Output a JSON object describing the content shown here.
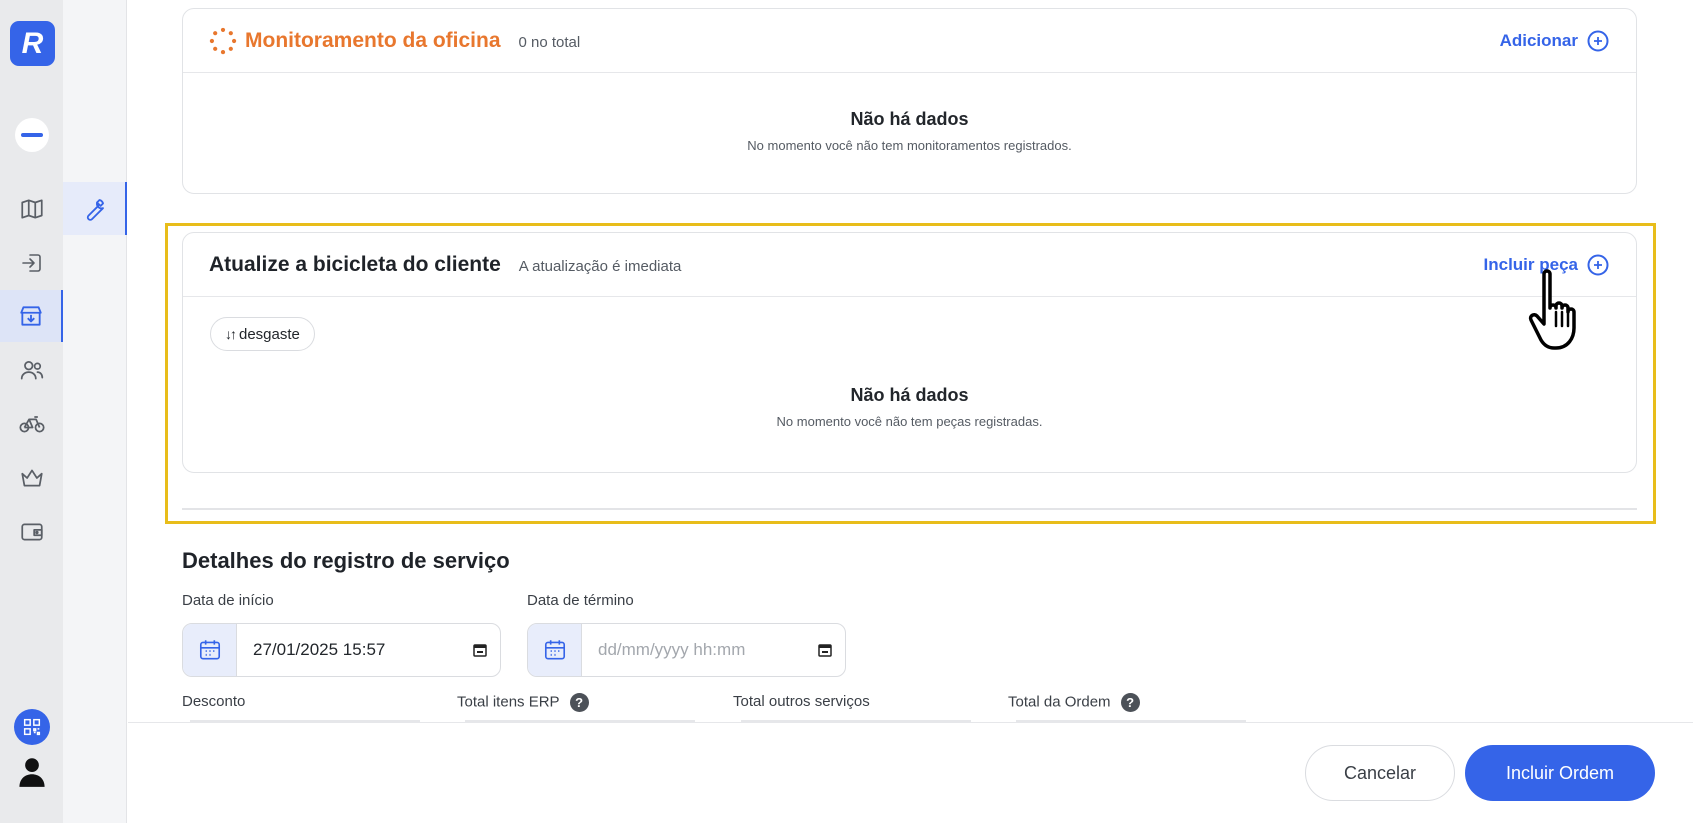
{
  "sidebar": {
    "logo_letter": "R",
    "items": [
      {
        "icon": "map-icon"
      },
      {
        "icon": "login-icon"
      },
      {
        "icon": "workshop-store-icon",
        "active": true
      },
      {
        "icon": "users-icon"
      },
      {
        "icon": "bicycle-icon"
      },
      {
        "icon": "crown-icon"
      },
      {
        "icon": "wallet-icon"
      }
    ]
  },
  "subbar": {
    "active_icon": "wrench-icon"
  },
  "monitoring": {
    "title": "Monitoramento da oficina",
    "count": "0 no total",
    "action": "Adicionar",
    "empty_title": "Não há dados",
    "empty_text": "No momento você não tem monitoramentos registrados.",
    "accent": "#e8772e"
  },
  "bike_update": {
    "title": "Atualize a bicicleta do cliente",
    "subtitle": "A atualização é imediata",
    "action": "Incluir peça",
    "sort_chip": "desgaste",
    "sort_icon": "↓↑",
    "empty_title": "Não há dados",
    "empty_text": "No momento você não tem peças registradas."
  },
  "details": {
    "title": "Detalhes do registro de serviço",
    "start_label": "Data de início",
    "start_value": "27/01/2025 15:57",
    "end_label": "Data de término",
    "end_placeholder": "dd/mm/yyyy hh:mm",
    "discount_label": "Desconto",
    "erp_label": "Total itens ERP",
    "other_label": "Total outros serviços",
    "order_label": "Total da Ordem",
    "help_symbol": "?"
  },
  "footer": {
    "cancel": "Cancelar",
    "submit": "Incluir Ordem"
  },
  "colors": {
    "primary": "#3564e8",
    "highlight": "#e8bd1a"
  }
}
